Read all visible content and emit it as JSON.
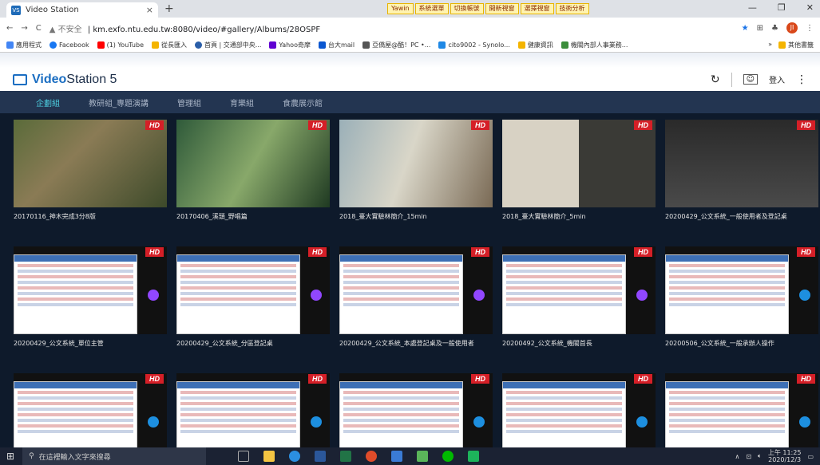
{
  "browser": {
    "tab_title": "Video Station",
    "tab_close": "×",
    "new_tab": "+",
    "toolbar_ext": [
      "Yawin",
      "系統選單",
      "切換帳號",
      "開新視窗",
      "選擇視窗",
      "技術分析"
    ],
    "url_warning": "▲ 不安全",
    "url": "km.exfo.ntu.edu.tw:8080/video/#gallery/Albums/28OSPF",
    "profile_initial": "JI"
  },
  "bookmarks": {
    "items": [
      "應用程式",
      "Facebook",
      "(1) YouTube",
      "從長匯入",
      "首頁 | 交通部中央...",
      "Yahoo奇摩",
      "台大mail",
      "亞僑屋@酷！PC •...",
      "cito9002 - Synolo...",
      "健康資訊",
      "機關內部人事業務..."
    ],
    "more": "»",
    "other": "其他書籤"
  },
  "app": {
    "logo_bold": "Video",
    "logo_rest": "Station 5",
    "login": "登入",
    "menu": "⋮"
  },
  "nav": {
    "tabs": [
      "企劃組",
      "教研組_專題演講",
      "管理組",
      "育樂組",
      "食農展示館"
    ]
  },
  "videos": [
    {
      "title": "20170116_神木完成3分8版",
      "hd": "HD"
    },
    {
      "title": "20170406_溪頭_野唱篇",
      "hd": "HD"
    },
    {
      "title": "2018_臺大實驗林簡介_15min",
      "hd": "HD"
    },
    {
      "title": "2018_臺大實驗林簡介_5min",
      "hd": "HD"
    },
    {
      "title": "20200429_公文系統_一般使用者及登記桌",
      "hd": "HD"
    },
    {
      "title": "20200429_公文系統_單位主管",
      "hd": "HD"
    },
    {
      "title": "20200429_公文系統_分區登記桌",
      "hd": "HD"
    },
    {
      "title": "20200429_公文系統_本處登記桌及一般使用者",
      "hd": "HD"
    },
    {
      "title": "20200492_公文系統_機關首長",
      "hd": "HD"
    },
    {
      "title": "20200506_公文系統_一般承辦人操作",
      "hd": "HD"
    },
    {
      "title": "",
      "hd": "HD"
    },
    {
      "title": "",
      "hd": "HD"
    },
    {
      "title": "",
      "hd": "HD"
    },
    {
      "title": "",
      "hd": "HD"
    },
    {
      "title": "",
      "hd": "HD"
    }
  ],
  "taskbar": {
    "search_placeholder": "在這裡輸入文字來搜尋",
    "time": "上午 11:25",
    "date": "2020/12/3"
  }
}
